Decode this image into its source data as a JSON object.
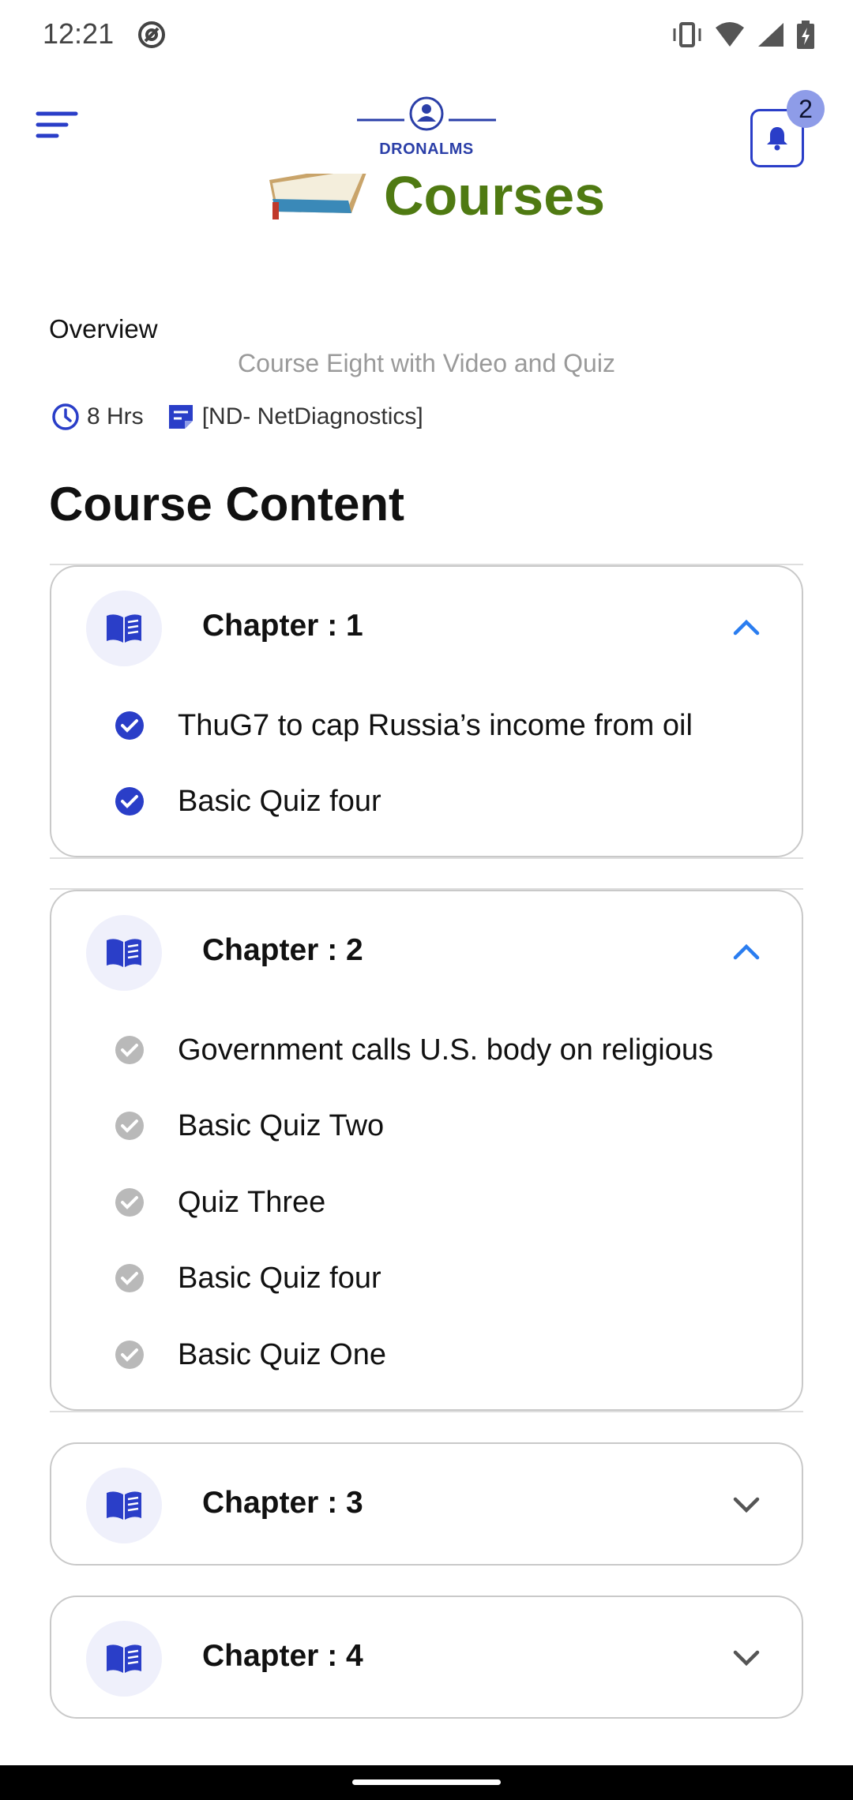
{
  "status_bar": {
    "time": "12:21",
    "icons": [
      "vibrate-icon",
      "wifi-icon",
      "signal-icon",
      "battery-charging-icon"
    ]
  },
  "header": {
    "logo_text": "DRONALMS",
    "notification_count": "2",
    "accent_color": "#2a3ec8"
  },
  "banner": {
    "title": "Courses"
  },
  "overview": {
    "label": "Overview",
    "course_name": "Course Eight with Video and Quiz",
    "duration": "8 Hrs",
    "category": "[ND- NetDiagnostics]"
  },
  "content": {
    "title": "Course Content",
    "chapters": [
      {
        "title": "Chapter : 1",
        "expanded": true,
        "lessons": [
          {
            "label": "ThuG7 to cap Russia’s income from oil",
            "completed": true
          },
          {
            "label": "Basic Quiz four",
            "completed": true
          }
        ]
      },
      {
        "title": "Chapter : 2",
        "expanded": true,
        "lessons": [
          {
            "label": "Government calls U.S. body on religious",
            "completed": false
          },
          {
            "label": "Basic Quiz Two",
            "completed": false
          },
          {
            "label": "Quiz Three",
            "completed": false
          },
          {
            "label": "Basic Quiz four",
            "completed": false
          },
          {
            "label": "Basic Quiz One",
            "completed": false
          }
        ]
      },
      {
        "title": "Chapter : 3",
        "expanded": false,
        "lessons": []
      },
      {
        "title": "Chapter : 4",
        "expanded": false,
        "lessons": []
      }
    ]
  }
}
